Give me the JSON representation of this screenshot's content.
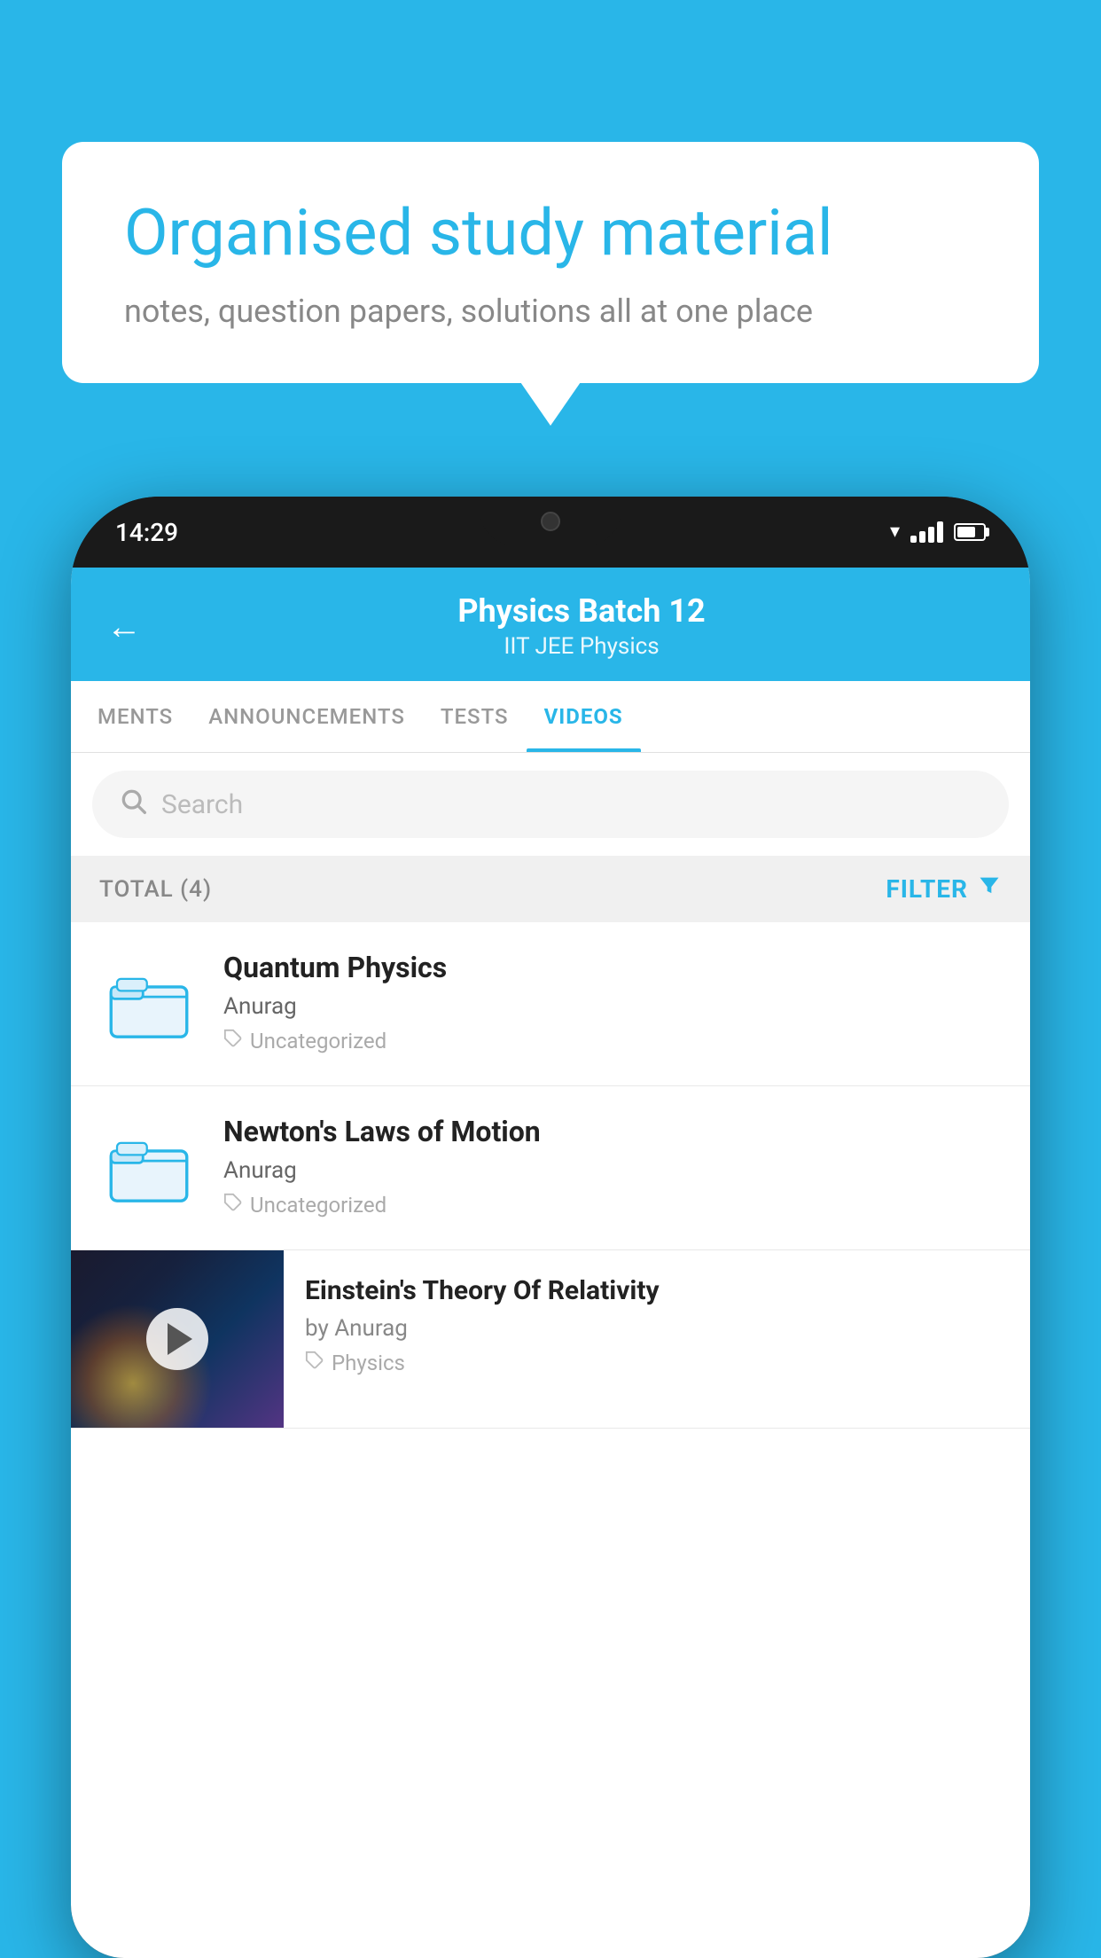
{
  "background_color": "#29b6e8",
  "speech_bubble": {
    "title": "Organised study material",
    "subtitle": "notes, question papers, solutions all at one place"
  },
  "phone": {
    "status_bar": {
      "time": "14:29"
    },
    "header": {
      "title": "Physics Batch 12",
      "subtitle": "IIT JEE   Physics",
      "back_label": "←"
    },
    "tabs": [
      {
        "label": "MENTS",
        "active": false
      },
      {
        "label": "ANNOUNCEMENTS",
        "active": false
      },
      {
        "label": "TESTS",
        "active": false
      },
      {
        "label": "VIDEOS",
        "active": true
      }
    ],
    "search": {
      "placeholder": "Search"
    },
    "filter_bar": {
      "total_label": "TOTAL (4)",
      "filter_label": "FILTER"
    },
    "videos": [
      {
        "id": 1,
        "title": "Quantum Physics",
        "author": "Anurag",
        "tag": "Uncategorized",
        "has_thumbnail": false
      },
      {
        "id": 2,
        "title": "Newton's Laws of Motion",
        "author": "Anurag",
        "tag": "Uncategorized",
        "has_thumbnail": false
      },
      {
        "id": 3,
        "title": "Einstein's Theory Of Relativity",
        "author": "by Anurag",
        "tag": "Physics",
        "has_thumbnail": true
      }
    ]
  }
}
